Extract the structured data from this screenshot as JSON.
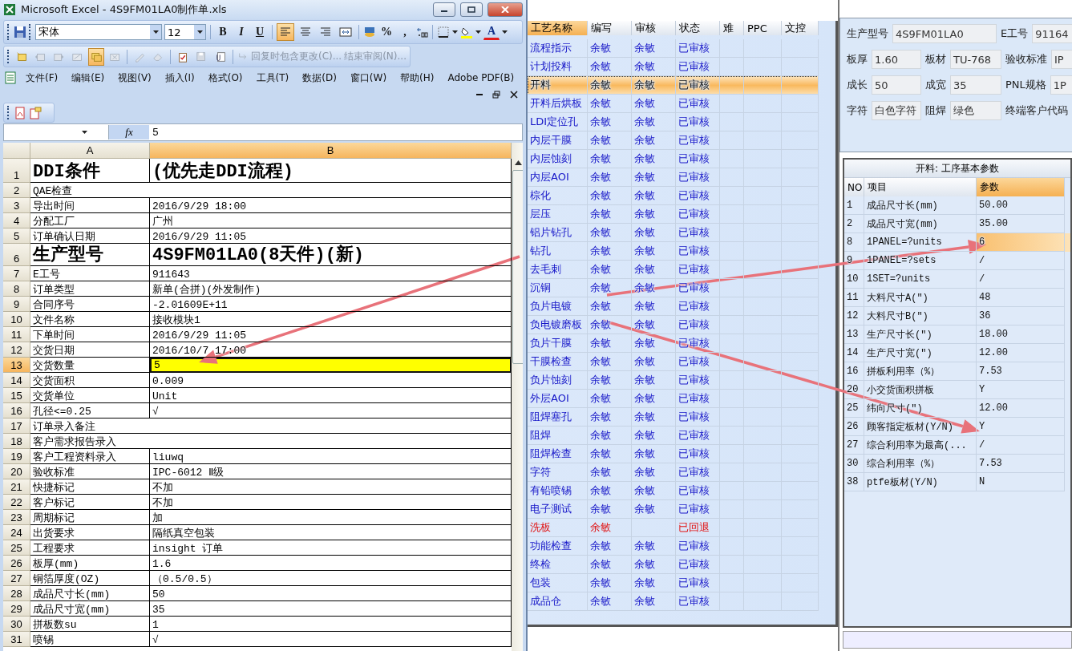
{
  "excel": {
    "title": "Microsoft Excel - 4S9FM01LA0制作单.xls",
    "font": "宋体",
    "size": "12",
    "style_buttons": [
      "B",
      "I",
      "U"
    ],
    "align_buttons": [
      {
        "selected": true
      },
      {
        "selected": false
      },
      {
        "selected": false
      },
      {
        "selected": false
      }
    ],
    "number_buttons": [
      "%",
      ","
    ],
    "font_color_label": "A",
    "review_buttons": [
      {
        "selected": false
      },
      {
        "selected": false
      },
      {
        "selected": false
      },
      {
        "selected": false
      },
      {
        "selected": true
      },
      {
        "selected": false
      },
      {
        "selected": false
      },
      {
        "selected": false
      },
      {
        "selected": false
      },
      {
        "selected": false
      },
      {
        "selected": false
      }
    ],
    "review_texts": [
      "回复时包含更改(C)...",
      "结束审阅(N)..."
    ],
    "menu": [
      "文件(F)",
      "编辑(E)",
      "视图(V)",
      "插入(I)",
      "格式(O)",
      "工具(T)",
      "数据(D)",
      "窗口(W)",
      "帮助(H)",
      "Adobe PDF(B)"
    ],
    "fx": "fx",
    "formula": "5",
    "sheet": {
      "columns": [
        {
          "label": "A",
          "selected": false
        },
        {
          "label": "B",
          "selected": true
        }
      ],
      "rows": [
        {
          "n": "1",
          "a": "DDI条件",
          "b": "(优先走DDI流程)",
          "kind": "large",
          "selected": false
        },
        {
          "n": "2",
          "a": "QAE检查",
          "kind": "span",
          "selected": false
        },
        {
          "n": "3",
          "a": "导出时间",
          "b": "2016/9/29 18:00",
          "kind": "normal",
          "selected": false
        },
        {
          "n": "4",
          "a": "分配工厂",
          "b": "广州",
          "kind": "normal",
          "selected": false
        },
        {
          "n": "5",
          "a": "订单确认日期",
          "b": "2016/9/29 11:05",
          "kind": "normal",
          "selected": false
        },
        {
          "n": "6",
          "a": "生产型号",
          "b": "4S9FM01LA0(8天件)(新)",
          "kind": "large",
          "selected": false
        },
        {
          "n": "7",
          "a": "E工号",
          "b": "911643",
          "kind": "normal",
          "selected": false
        },
        {
          "n": "8",
          "a": "订单类型",
          "b": "新单(合拼)(外发制作)",
          "kind": "normal",
          "selected": false
        },
        {
          "n": "9",
          "a": "合同序号",
          "b": "-2.01609E+11",
          "kind": "normal",
          "selected": false
        },
        {
          "n": "10",
          "a": "文件名称",
          "b": "接收模块1",
          "kind": "normal",
          "selected": false
        },
        {
          "n": "11",
          "a": "下单时间",
          "b": "2016/9/29 11:05",
          "kind": "normal",
          "selected": false
        },
        {
          "n": "12",
          "a": "交货日期",
          "b": "2016/10/7 17:00",
          "kind": "normal",
          "selected": false
        },
        {
          "n": "13",
          "a": "交货数量",
          "b": "5",
          "kind": "normal",
          "selected": true
        },
        {
          "n": "14",
          "a": "交货面积",
          "b": "0.009",
          "kind": "normal",
          "selected": false
        },
        {
          "n": "15",
          "a": "交货单位",
          "b": "Unit",
          "kind": "normal",
          "selected": false
        },
        {
          "n": "16",
          "a": "孔径<=0.25",
          "b": "√",
          "kind": "normal",
          "selected": false
        },
        {
          "n": "17",
          "a": "订单录入备注",
          "kind": "span",
          "selected": false
        },
        {
          "n": "18",
          "a": "客户需求报告录入",
          "kind": "span",
          "selected": false
        },
        {
          "n": "19",
          "a": "客户工程资料录入",
          "b": "liuwq",
          "kind": "normal",
          "selected": false
        },
        {
          "n": "20",
          "a": "验收标准",
          "b": "IPC-6012 Ⅱ级",
          "kind": "normal",
          "selected": false
        },
        {
          "n": "21",
          "a": "快捷标记",
          "b": "不加",
          "kind": "normal",
          "selected": false
        },
        {
          "n": "22",
          "a": "客户标记",
          "b": "不加",
          "kind": "normal",
          "selected": false
        },
        {
          "n": "23",
          "a": "周期标记",
          "b": "加",
          "kind": "normal",
          "selected": false
        },
        {
          "n": "24",
          "a": "出货要求",
          "b": "隔纸真空包装",
          "kind": "normal",
          "selected": false
        },
        {
          "n": "25",
          "a": "工程要求",
          "b": "insight 订单",
          "kind": "normal",
          "selected": false
        },
        {
          "n": "26",
          "a": "板厚(mm)",
          "b": "1.6",
          "kind": "normal",
          "selected": false
        },
        {
          "n": "27",
          "a": "铜箔厚度(OZ)",
          "b": "（0.5/0.5）",
          "kind": "normal",
          "selected": false
        },
        {
          "n": "28",
          "a": "成品尺寸长(mm)",
          "b": "50",
          "kind": "normal",
          "selected": false
        },
        {
          "n": "29",
          "a": "成品尺寸宽(mm)",
          "b": "35",
          "kind": "normal",
          "selected": false
        },
        {
          "n": "30",
          "a": "拼板数su",
          "b": "1",
          "kind": "normal",
          "selected": false
        },
        {
          "n": "31",
          "a": "喷锡",
          "b": "√",
          "kind": "normal",
          "selected": false
        }
      ]
    }
  },
  "process_table": {
    "columns": [
      {
        "label": "工艺名称",
        "selected": true
      },
      {
        "label": "编写",
        "selected": false
      },
      {
        "label": "审核",
        "selected": false
      },
      {
        "label": "状态",
        "selected": false
      },
      {
        "label": "难",
        "selected": false
      },
      {
        "label": "PPC",
        "selected": false
      },
      {
        "label": "文控",
        "selected": false
      }
    ],
    "rows": [
      {
        "name": "流程指示",
        "writer": "余敏",
        "reviewer": "余敏",
        "status": "已审核",
        "kind": "approved",
        "selected": false
      },
      {
        "name": "计划投料",
        "writer": "余敏",
        "reviewer": "余敏",
        "status": "已审核",
        "kind": "approved",
        "selected": false
      },
      {
        "name": "开料",
        "writer": "余敏",
        "reviewer": "余敏",
        "status": "已审核",
        "kind": "approved",
        "selected": true
      },
      {
        "name": "开料后烘板",
        "writer": "余敏",
        "reviewer": "余敏",
        "status": "已审核",
        "kind": "approved",
        "selected": false
      },
      {
        "name": "LDI定位孔",
        "writer": "余敏",
        "reviewer": "余敏",
        "status": "已审核",
        "kind": "approved",
        "selected": false
      },
      {
        "name": "内层干膜",
        "writer": "余敏",
        "reviewer": "余敏",
        "status": "已审核",
        "kind": "approved",
        "selected": false
      },
      {
        "name": "内层蚀刻",
        "writer": "余敏",
        "reviewer": "余敏",
        "status": "已审核",
        "kind": "approved",
        "selected": false
      },
      {
        "name": "内层AOI",
        "writer": "余敏",
        "reviewer": "余敏",
        "status": "已审核",
        "kind": "approved",
        "selected": false
      },
      {
        "name": "棕化",
        "writer": "余敏",
        "reviewer": "余敏",
        "status": "已审核",
        "kind": "approved",
        "selected": false
      },
      {
        "name": "层压",
        "writer": "余敏",
        "reviewer": "余敏",
        "status": "已审核",
        "kind": "approved",
        "selected": false
      },
      {
        "name": "铝片钻孔",
        "writer": "余敏",
        "reviewer": "余敏",
        "status": "已审核",
        "kind": "approved",
        "selected": false
      },
      {
        "name": "钻孔",
        "writer": "余敏",
        "reviewer": "余敏",
        "status": "已审核",
        "kind": "approved",
        "selected": false
      },
      {
        "name": "去毛刺",
        "writer": "余敏",
        "reviewer": "余敏",
        "status": "已审核",
        "kind": "approved",
        "selected": false
      },
      {
        "name": "沉铜",
        "writer": "余敏",
        "reviewer": "余敏",
        "status": "已审核",
        "kind": "approved",
        "selected": false
      },
      {
        "name": "负片电镀",
        "writer": "余敏",
        "reviewer": "余敏",
        "status": "已审核",
        "kind": "approved",
        "selected": false
      },
      {
        "name": "负电镀磨板",
        "writer": "余敏",
        "reviewer": "余敏",
        "status": "已审核",
        "kind": "approved",
        "selected": false
      },
      {
        "name": "负片干膜",
        "writer": "余敏",
        "reviewer": "余敏",
        "status": "已审核",
        "kind": "approved",
        "selected": false
      },
      {
        "name": "干膜检查",
        "writer": "余敏",
        "reviewer": "余敏",
        "status": "已审核",
        "kind": "approved",
        "selected": false
      },
      {
        "name": "负片蚀刻",
        "writer": "余敏",
        "reviewer": "余敏",
        "status": "已审核",
        "kind": "approved",
        "selected": false
      },
      {
        "name": "外层AOI",
        "writer": "余敏",
        "reviewer": "余敏",
        "status": "已审核",
        "kind": "approved",
        "selected": false
      },
      {
        "name": "阻焊塞孔",
        "writer": "余敏",
        "reviewer": "余敏",
        "status": "已审核",
        "kind": "approved",
        "selected": false
      },
      {
        "name": "阻焊",
        "writer": "余敏",
        "reviewer": "余敏",
        "status": "已审核",
        "kind": "approved",
        "selected": false
      },
      {
        "name": "阻焊检查",
        "writer": "余敏",
        "reviewer": "余敏",
        "status": "已审核",
        "kind": "approved",
        "selected": false
      },
      {
        "name": "字符",
        "writer": "余敏",
        "reviewer": "余敏",
        "status": "已审核",
        "kind": "approved",
        "selected": false
      },
      {
        "name": "有铅喷锡",
        "writer": "余敏",
        "reviewer": "余敏",
        "status": "已审核",
        "kind": "approved",
        "selected": false
      },
      {
        "name": "电子测试",
        "writer": "余敏",
        "reviewer": "余敏",
        "status": "已审核",
        "kind": "approved",
        "selected": false
      },
      {
        "name": "洗板",
        "writer": "余敏",
        "status": "已回退",
        "kind": "returned",
        "selected": false
      },
      {
        "name": "功能检查",
        "writer": "余敏",
        "reviewer": "余敏",
        "status": "已审核",
        "kind": "approved",
        "selected": false
      },
      {
        "name": "终检",
        "writer": "余敏",
        "reviewer": "余敏",
        "status": "已审核",
        "kind": "approved",
        "selected": false
      },
      {
        "name": "包装",
        "writer": "余敏",
        "reviewer": "余敏",
        "status": "已审核",
        "kind": "approved",
        "selected": false
      },
      {
        "name": "成品仓",
        "writer": "余敏",
        "reviewer": "余敏",
        "status": "已审核",
        "kind": "approved",
        "selected": false
      }
    ]
  },
  "order_form": {
    "rows": [
      {
        "fields": [
          {
            "label": "生产型号",
            "value": "4S9FM01LA0"
          },
          {
            "label": "E工号",
            "value": "91164"
          }
        ]
      },
      {
        "fields": [
          {
            "label": "板厚",
            "value": "1.60"
          },
          {
            "label": "板材",
            "value": "TU-768"
          },
          {
            "label": "验收标准",
            "value": "IP"
          }
        ]
      },
      {
        "fields": [
          {
            "label": "成长",
            "value": "50"
          },
          {
            "label": "成宽",
            "value": "35"
          },
          {
            "label": "PNL规格",
            "value": "1P"
          }
        ]
      },
      {
        "fields": [
          {
            "label": "字符",
            "value": "白色字符"
          },
          {
            "label": "阻焊",
            "value": "绿色"
          },
          {
            "label": "终端客户代码"
          }
        ]
      }
    ]
  },
  "params": {
    "title": "开料: 工序基本参数",
    "columns": [
      {
        "label": "NO",
        "selected": false
      },
      {
        "label": "项目",
        "selected": false
      },
      {
        "label": "参数",
        "selected": true
      }
    ],
    "rows": [
      {
        "no": "1",
        "item": "成品尺寸长(mm)",
        "value": "50.00",
        "selected": false
      },
      {
        "no": "2",
        "item": "成品尺寸宽(mm)",
        "value": "35.00",
        "selected": false
      },
      {
        "no": "8",
        "item": "1PANEL=?units",
        "value": "6",
        "selected": true
      },
      {
        "no": "9",
        "item": "1PANEL=?sets",
        "value": "/",
        "selected": false
      },
      {
        "no": "10",
        "item": "1SET=?units",
        "value": "/",
        "selected": false
      },
      {
        "no": "11",
        "item": "大料尺寸A(\")",
        "value": "48",
        "selected": false
      },
      {
        "no": "12",
        "item": "大料尺寸B(\")",
        "value": "36",
        "selected": false
      },
      {
        "no": "13",
        "item": "生产尺寸长(\")",
        "value": "18.00",
        "selected": false
      },
      {
        "no": "14",
        "item": "生产尺寸宽(\")",
        "value": "12.00",
        "selected": false
      },
      {
        "no": "16",
        "item": "拼板利用率（%）",
        "value": "7.53",
        "selected": false
      },
      {
        "no": "20",
        "item": "小交货面积拼板",
        "value": "Y",
        "selected": false
      },
      {
        "no": "25",
        "item": "纬向尺寸(\")",
        "value": "12.00",
        "selected": false
      },
      {
        "no": "26",
        "item": "顾客指定板材(Y/N)",
        "value": "Y",
        "selected": false
      },
      {
        "no": "27",
        "item": "综合利用率为最高(...",
        "value": "/",
        "selected": false
      },
      {
        "no": "30",
        "item": "综合利用率（%）",
        "value": "7.53",
        "selected": false
      },
      {
        "no": "38",
        "item": "ptfe板材(Y/N)",
        "value": "N",
        "selected": false
      }
    ]
  }
}
